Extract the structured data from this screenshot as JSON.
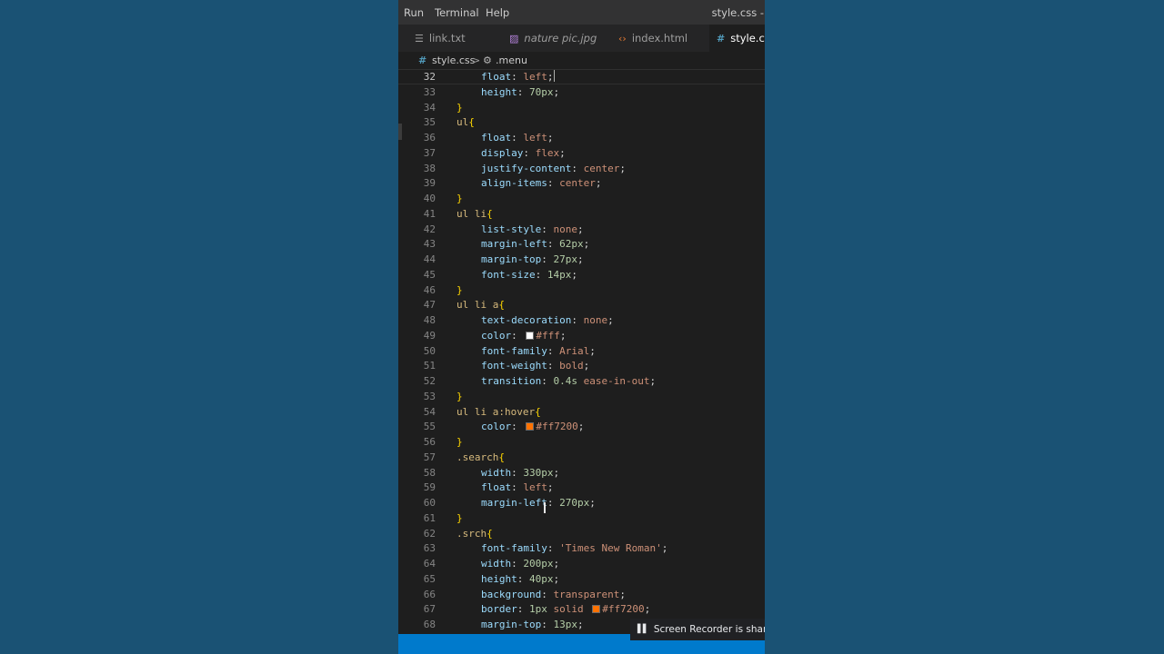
{
  "menubar": {
    "items": [
      "Run",
      "Terminal",
      "Help"
    ],
    "window_title": "style.css -"
  },
  "tabs": [
    {
      "label": "link.txt",
      "icon": "lines-icon"
    },
    {
      "label": "nature pic.jpg",
      "icon": "image-icon"
    },
    {
      "label": "index.html",
      "icon": "html-icon"
    },
    {
      "label": "style.css",
      "icon": "css-hash-icon",
      "active": true
    }
  ],
  "breadcrumb": {
    "file": "style.css",
    "separator": ">",
    "symbol": ".menu"
  },
  "editor": {
    "current_line": 32,
    "lines": [
      {
        "n": 32,
        "text": "    float: left;"
      },
      {
        "n": 33,
        "text": "    height: 70px;"
      },
      {
        "n": 34,
        "text": "}"
      },
      {
        "n": 35,
        "text": "ul{"
      },
      {
        "n": 36,
        "text": "    float: left;"
      },
      {
        "n": 37,
        "text": "    display: flex;"
      },
      {
        "n": 38,
        "text": "    justify-content: center;"
      },
      {
        "n": 39,
        "text": "    align-items: center;"
      },
      {
        "n": 40,
        "text": "}"
      },
      {
        "n": 41,
        "text": "ul li{"
      },
      {
        "n": 42,
        "text": "    list-style: none;"
      },
      {
        "n": 43,
        "text": "    margin-left: 62px;"
      },
      {
        "n": 44,
        "text": "    margin-top: 27px;"
      },
      {
        "n": 45,
        "text": "    font-size: 14px;"
      },
      {
        "n": 46,
        "text": "}"
      },
      {
        "n": 47,
        "text": "ul li a{"
      },
      {
        "n": 48,
        "text": "    text-decoration: none;"
      },
      {
        "n": 49,
        "text": "    color: #fff;",
        "swatch": "#ffffff"
      },
      {
        "n": 50,
        "text": "    font-family: Arial;"
      },
      {
        "n": 51,
        "text": "    font-weight: bold;"
      },
      {
        "n": 52,
        "text": "    transition: 0.4s ease-in-out;"
      },
      {
        "n": 53,
        "text": "}"
      },
      {
        "n": 54,
        "text": "ul li a:hover{"
      },
      {
        "n": 55,
        "text": "    color: #ff7200;",
        "swatch": "#ff7200"
      },
      {
        "n": 56,
        "text": "}"
      },
      {
        "n": 57,
        "text": ".search{"
      },
      {
        "n": 58,
        "text": "    width: 330px;"
      },
      {
        "n": 59,
        "text": "    float: left;"
      },
      {
        "n": 60,
        "text": "    margin-left: 270px;"
      },
      {
        "n": 61,
        "text": "}"
      },
      {
        "n": 62,
        "text": ".srch{"
      },
      {
        "n": 63,
        "text": "    font-family: 'Times New Roman';"
      },
      {
        "n": 64,
        "text": "    width: 200px;"
      },
      {
        "n": 65,
        "text": "    height: 40px;"
      },
      {
        "n": 66,
        "text": "    background: transparent;"
      },
      {
        "n": 67,
        "text": "    border: 1px solid #ff7200;",
        "swatch": "#ff7200"
      },
      {
        "n": 68,
        "text": "    margin-top: 13px;"
      }
    ]
  },
  "toast": {
    "text": "Screen Recorder is sharing"
  },
  "colors": {
    "background": "#1a5274",
    "editor_bg": "#1e1e1e",
    "statusbar": "#007acc",
    "accent_orange": "#ff7200"
  }
}
